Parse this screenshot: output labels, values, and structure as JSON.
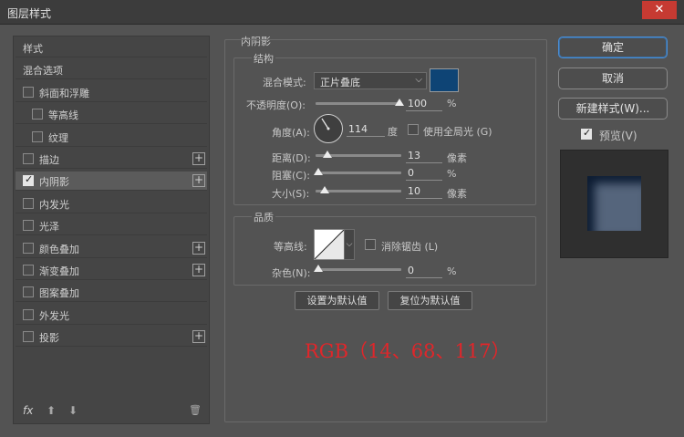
{
  "window": {
    "title": "图层样式",
    "close_glyph": "✕"
  },
  "left_panel": {
    "items": [
      {
        "label": "样式",
        "has_checkbox": false,
        "checked": false,
        "has_plus": false,
        "indent": 0
      },
      {
        "label": "混合选项",
        "has_checkbox": false,
        "checked": false,
        "has_plus": false,
        "indent": 0
      },
      {
        "label": "斜面和浮雕",
        "has_checkbox": true,
        "checked": false,
        "has_plus": false,
        "indent": 0
      },
      {
        "label": "等高线",
        "has_checkbox": true,
        "checked": false,
        "has_plus": false,
        "indent": 1
      },
      {
        "label": "纹理",
        "has_checkbox": true,
        "checked": false,
        "has_plus": false,
        "indent": 1
      },
      {
        "label": "描边",
        "has_checkbox": true,
        "checked": false,
        "has_plus": true,
        "indent": 0
      },
      {
        "label": "内阴影",
        "has_checkbox": true,
        "checked": true,
        "has_plus": true,
        "indent": 0,
        "selected": true
      },
      {
        "label": "内发光",
        "has_checkbox": true,
        "checked": false,
        "has_plus": false,
        "indent": 0
      },
      {
        "label": "光泽",
        "has_checkbox": true,
        "checked": false,
        "has_plus": false,
        "indent": 0
      },
      {
        "label": "颜色叠加",
        "has_checkbox": true,
        "checked": false,
        "has_plus": true,
        "indent": 0
      },
      {
        "label": "渐变叠加",
        "has_checkbox": true,
        "checked": false,
        "has_plus": true,
        "indent": 0
      },
      {
        "label": "图案叠加",
        "has_checkbox": true,
        "checked": false,
        "has_plus": false,
        "indent": 0
      },
      {
        "label": "外发光",
        "has_checkbox": true,
        "checked": false,
        "has_plus": false,
        "indent": 0
      },
      {
        "label": "投影",
        "has_checkbox": true,
        "checked": false,
        "has_plus": true,
        "indent": 0
      }
    ],
    "footer": {
      "fx": "fx",
      "up_glyph": "⬆",
      "down_glyph": "⬇",
      "trash_glyph": "🗑"
    }
  },
  "inner_shadow": {
    "section_title": "内阴影",
    "structure_title": "结构",
    "blend_mode_label": "混合模式:",
    "blend_mode_value": "正片叠底",
    "color": "#0e4475",
    "opacity_label": "不透明度(O):",
    "opacity_value": "100",
    "opacity_unit": "%",
    "angle_label": "角度(A):",
    "angle_value": "114",
    "angle_unit": "度",
    "global_light_label": "使用全局光 (G)",
    "global_light_checked": false,
    "distance_label": "距离(D):",
    "distance_value": "13",
    "distance_unit": "像素",
    "choke_label": "阻塞(C):",
    "choke_value": "0",
    "choke_unit": "%",
    "size_label": "大小(S):",
    "size_value": "10",
    "size_unit": "像素",
    "quality_title": "品质",
    "contour_label": "等高线:",
    "antialias_label": "消除锯齿 (L)",
    "antialias_checked": false,
    "noise_label": "杂色(N):",
    "noise_value": "0",
    "noise_unit": "%",
    "set_default_label": "设置为默认值",
    "reset_default_label": "复位为默认值"
  },
  "right_panel": {
    "ok_label": "确定",
    "cancel_label": "取消",
    "new_style_label": "新建样式(W)...",
    "preview_label": "预览(V)",
    "preview_checked": true
  },
  "annotation": {
    "text": "RGB（14、68、117）",
    "color": "#e0262a"
  }
}
